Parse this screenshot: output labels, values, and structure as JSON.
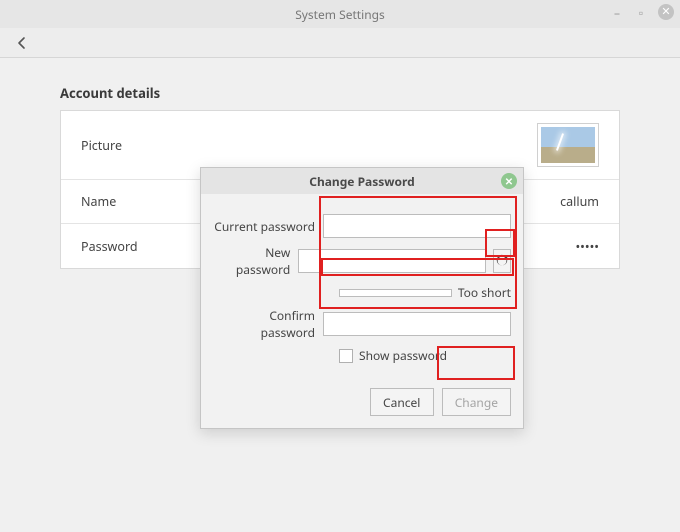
{
  "window": {
    "title": "System Settings"
  },
  "section": {
    "heading": "Account details"
  },
  "rows": {
    "picture_label": "Picture",
    "name_label": "Name",
    "name_value": "callum",
    "password_label": "Password",
    "password_value": "•••••"
  },
  "dialog": {
    "title": "Change Password",
    "current_label": "Current password",
    "new_label": "New password",
    "confirm_label": "Confirm password",
    "strength_text": "Too short",
    "show_password_label": "Show password",
    "cancel": "Cancel",
    "change": "Change",
    "current_value": "",
    "new_value": "",
    "confirm_value": ""
  }
}
